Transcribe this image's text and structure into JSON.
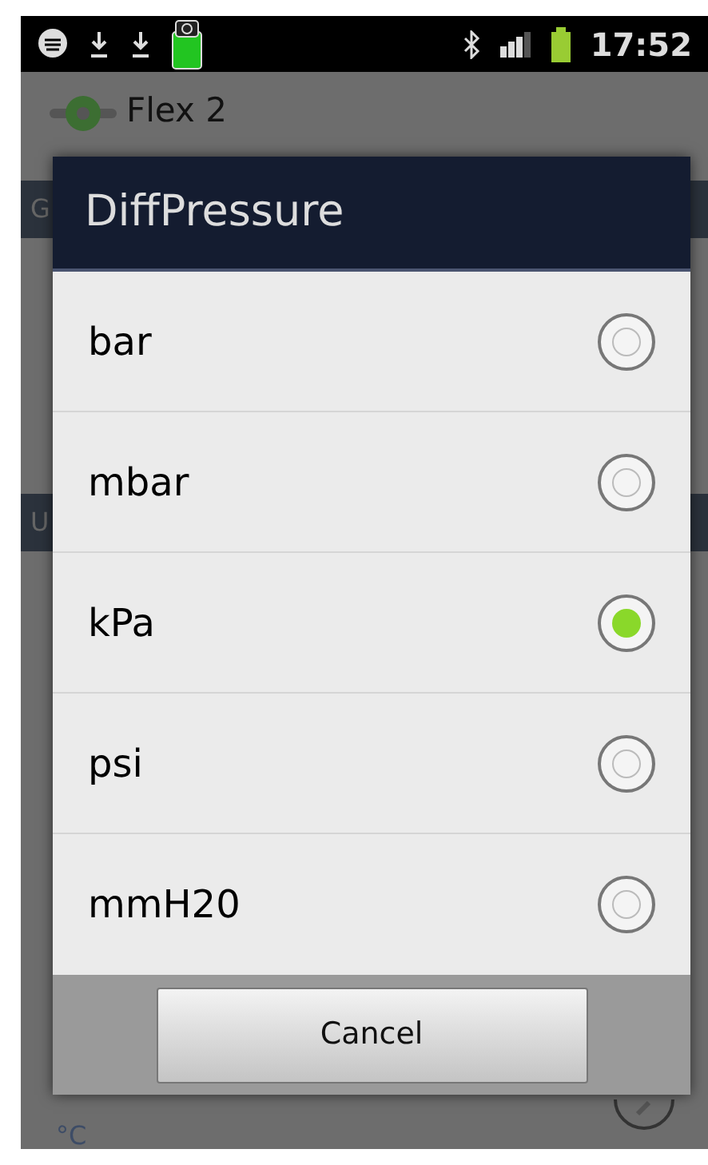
{
  "status_bar": {
    "time": "17:52"
  },
  "background": {
    "app_title": "Flex 2",
    "sections": [
      {
        "header": "G"
      },
      {
        "header": "U"
      }
    ],
    "unit_hint": "°C"
  },
  "dialog": {
    "title": "DiffPressure",
    "options": [
      {
        "label": "bar",
        "selected": false
      },
      {
        "label": "mbar",
        "selected": false
      },
      {
        "label": "kPa",
        "selected": true
      },
      {
        "label": "psi",
        "selected": false
      },
      {
        "label": "mmH20",
        "selected": false
      }
    ],
    "cancel": "Cancel"
  }
}
